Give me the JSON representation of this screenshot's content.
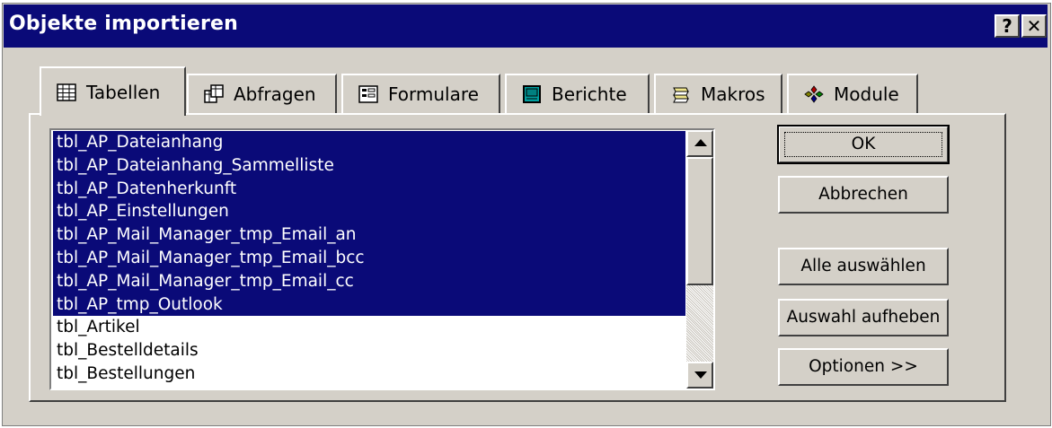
{
  "window": {
    "title": "Objekte importieren",
    "help_label": "?",
    "close_label": "✕"
  },
  "tabs": [
    {
      "label": "Tabellen",
      "icon": "table-icon",
      "active": true
    },
    {
      "label": "Abfragen",
      "icon": "query-icon",
      "active": false
    },
    {
      "label": "Formulare",
      "icon": "form-icon",
      "active": false
    },
    {
      "label": "Berichte",
      "icon": "report-icon",
      "active": false
    },
    {
      "label": "Makros",
      "icon": "macro-icon",
      "active": false
    },
    {
      "label": "Module",
      "icon": "module-icon",
      "active": false
    }
  ],
  "list": {
    "items": [
      {
        "label": "tbl_AP_Dateianhang",
        "selected": true
      },
      {
        "label": "tbl_AP_Dateianhang_Sammelliste",
        "selected": true
      },
      {
        "label": "tbl_AP_Datenherkunft",
        "selected": true
      },
      {
        "label": "tbl_AP_Einstellungen",
        "selected": true
      },
      {
        "label": "tbl_AP_Mail_Manager_tmp_Email_an",
        "selected": true
      },
      {
        "label": "tbl_AP_Mail_Manager_tmp_Email_bcc",
        "selected": true
      },
      {
        "label": "tbl_AP_Mail_Manager_tmp_Email_cc",
        "selected": true
      },
      {
        "label": "tbl_AP_tmp_Outlook",
        "selected": true
      },
      {
        "label": "tbl_Artikel",
        "selected": false
      },
      {
        "label": "tbl_Bestelldetails",
        "selected": false
      },
      {
        "label": "tbl_Bestellungen",
        "selected": false
      }
    ]
  },
  "buttons": {
    "ok": "OK",
    "cancel": "Abbrechen",
    "select_all": "Alle auswählen",
    "deselect": "Auswahl aufheben",
    "options": "Optionen >>"
  },
  "colors": {
    "titlebar": "#0a0a78",
    "selection": "#0a0a78",
    "face": "#d4d0c8"
  }
}
